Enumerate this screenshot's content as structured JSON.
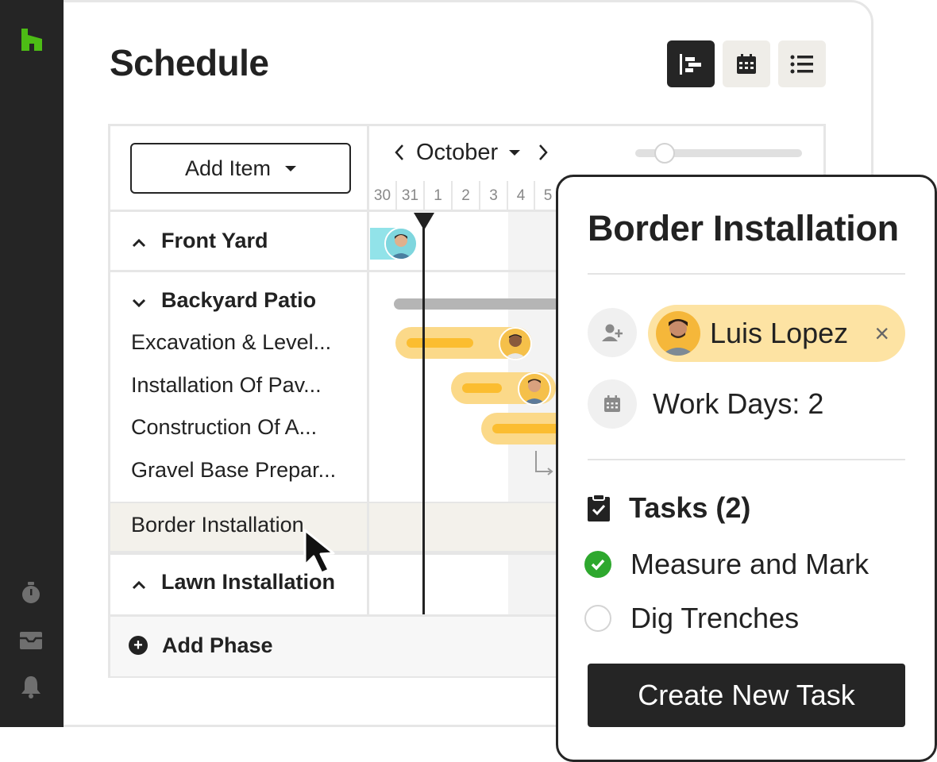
{
  "sidebar": {
    "logo": "houzz-logo",
    "icons": [
      "stopwatch-icon",
      "inbox-icon",
      "bell-icon"
    ]
  },
  "header": {
    "title": "Schedule",
    "views": [
      "gantt-view-icon",
      "calendar-view-icon",
      "list-view-icon"
    ],
    "active_view": "gantt-view-icon"
  },
  "toolbar": {
    "add_item_label": "Add Item",
    "month": "October"
  },
  "timeline": {
    "days": [
      "30",
      "31",
      "1",
      "2",
      "3",
      "4",
      "5"
    ]
  },
  "rows": {
    "front_yard": "Front Yard",
    "backyard_patio": "Backyard Patio",
    "items": [
      "Excavation & Level...",
      "Installation Of Pav...",
      "Construction Of A...",
      "Gravel Base Prepar..."
    ],
    "border_installation": "Border Installation",
    "lawn_installation": "Lawn Installation",
    "add_phase": "Add Phase"
  },
  "card": {
    "title": "Border Installation",
    "assignee": "Luis Lopez",
    "work_days": "Work Days: 2",
    "tasks_heading": "Tasks (2)",
    "tasks": [
      {
        "label": "Measure and Mark",
        "done": true
      },
      {
        "label": "Dig Trenches",
        "done": false
      }
    ],
    "create_button": "Create New Task"
  },
  "colors": {
    "brand_green": "#4dbc15",
    "bar_yellow": "#fbbd30",
    "bar_yellow_light": "#fbd989",
    "dark": "#252525",
    "done_green": "#2ea82e"
  }
}
